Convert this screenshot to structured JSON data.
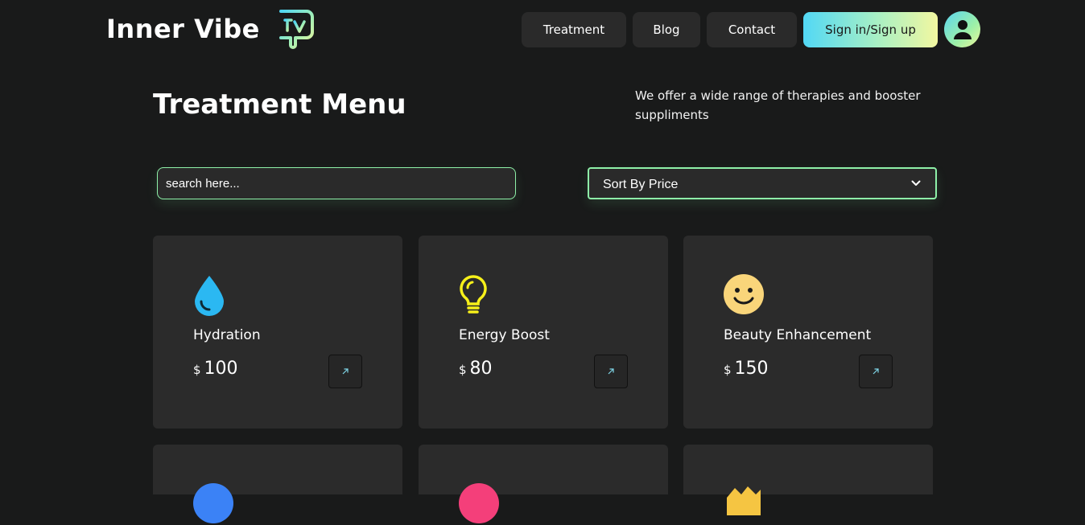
{
  "header": {
    "brand_name": "Inner Vibe",
    "nav": {
      "treatment": "Treatment",
      "blog": "Blog",
      "contact": "Contact",
      "signin": "Sign in/Sign up"
    }
  },
  "hero": {
    "title": "Treatment Menu",
    "tagline": "We offer a wide range of therapies and booster suppliments"
  },
  "controls": {
    "search_placeholder": "search here...",
    "sort_selected": "Sort By Price"
  },
  "cards": [
    {
      "title": "Hydration",
      "currency": "$",
      "price": "100",
      "icon": "water-drop-icon",
      "color": "#2bb8f2"
    },
    {
      "title": "Energy Boost",
      "currency": "$",
      "price": "80",
      "icon": "light-bulb-icon",
      "color": "#f6f01a"
    },
    {
      "title": "Beauty Enhancement",
      "currency": "$",
      "price": "150",
      "icon": "smiley-face-icon",
      "color": "#f9d57a"
    },
    {
      "icon": "blue-circle-icon",
      "color": "#3b82f6"
    },
    {
      "icon": "pink-circle-icon",
      "color": "#f43f7a"
    },
    {
      "icon": "crown-icon",
      "color": "#f5c542"
    }
  ],
  "colors": {
    "background": "#191a1a",
    "card": "#2b2b2b",
    "accent_border": "#8ef0a8"
  }
}
